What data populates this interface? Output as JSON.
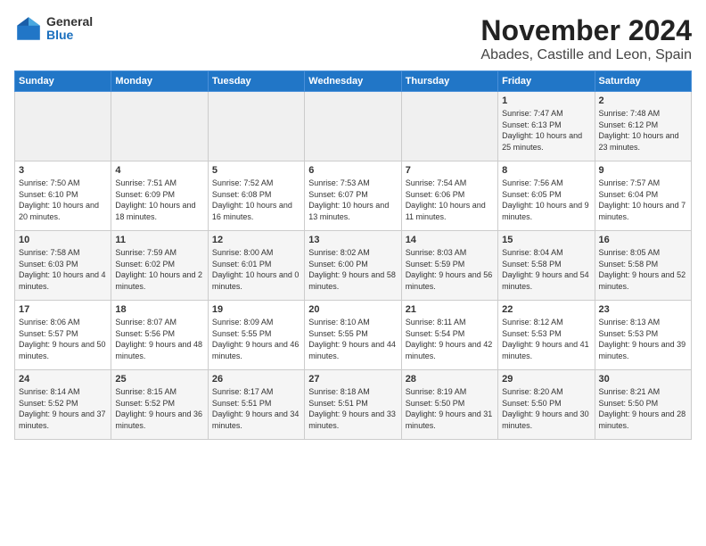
{
  "logo": {
    "general": "General",
    "blue": "Blue"
  },
  "title": "November 2024",
  "location": "Abades, Castille and Leon, Spain",
  "weekdays": [
    "Sunday",
    "Monday",
    "Tuesday",
    "Wednesday",
    "Thursday",
    "Friday",
    "Saturday"
  ],
  "weeks": [
    [
      {
        "day": "",
        "empty": true
      },
      {
        "day": "",
        "empty": true
      },
      {
        "day": "",
        "empty": true
      },
      {
        "day": "",
        "empty": true
      },
      {
        "day": "",
        "empty": true
      },
      {
        "day": "1",
        "sunrise": "7:47 AM",
        "sunset": "6:13 PM",
        "daylight": "10 hours and 25 minutes."
      },
      {
        "day": "2",
        "sunrise": "7:48 AM",
        "sunset": "6:12 PM",
        "daylight": "10 hours and 23 minutes."
      }
    ],
    [
      {
        "day": "3",
        "sunrise": "7:50 AM",
        "sunset": "6:10 PM",
        "daylight": "10 hours and 20 minutes."
      },
      {
        "day": "4",
        "sunrise": "7:51 AM",
        "sunset": "6:09 PM",
        "daylight": "10 hours and 18 minutes."
      },
      {
        "day": "5",
        "sunrise": "7:52 AM",
        "sunset": "6:08 PM",
        "daylight": "10 hours and 16 minutes."
      },
      {
        "day": "6",
        "sunrise": "7:53 AM",
        "sunset": "6:07 PM",
        "daylight": "10 hours and 13 minutes."
      },
      {
        "day": "7",
        "sunrise": "7:54 AM",
        "sunset": "6:06 PM",
        "daylight": "10 hours and 11 minutes."
      },
      {
        "day": "8",
        "sunrise": "7:56 AM",
        "sunset": "6:05 PM",
        "daylight": "10 hours and 9 minutes."
      },
      {
        "day": "9",
        "sunrise": "7:57 AM",
        "sunset": "6:04 PM",
        "daylight": "10 hours and 7 minutes."
      }
    ],
    [
      {
        "day": "10",
        "sunrise": "7:58 AM",
        "sunset": "6:03 PM",
        "daylight": "10 hours and 4 minutes."
      },
      {
        "day": "11",
        "sunrise": "7:59 AM",
        "sunset": "6:02 PM",
        "daylight": "10 hours and 2 minutes."
      },
      {
        "day": "12",
        "sunrise": "8:00 AM",
        "sunset": "6:01 PM",
        "daylight": "10 hours and 0 minutes."
      },
      {
        "day": "13",
        "sunrise": "8:02 AM",
        "sunset": "6:00 PM",
        "daylight": "9 hours and 58 minutes."
      },
      {
        "day": "14",
        "sunrise": "8:03 AM",
        "sunset": "5:59 PM",
        "daylight": "9 hours and 56 minutes."
      },
      {
        "day": "15",
        "sunrise": "8:04 AM",
        "sunset": "5:58 PM",
        "daylight": "9 hours and 54 minutes."
      },
      {
        "day": "16",
        "sunrise": "8:05 AM",
        "sunset": "5:58 PM",
        "daylight": "9 hours and 52 minutes."
      }
    ],
    [
      {
        "day": "17",
        "sunrise": "8:06 AM",
        "sunset": "5:57 PM",
        "daylight": "9 hours and 50 minutes."
      },
      {
        "day": "18",
        "sunrise": "8:07 AM",
        "sunset": "5:56 PM",
        "daylight": "9 hours and 48 minutes."
      },
      {
        "day": "19",
        "sunrise": "8:09 AM",
        "sunset": "5:55 PM",
        "daylight": "9 hours and 46 minutes."
      },
      {
        "day": "20",
        "sunrise": "8:10 AM",
        "sunset": "5:55 PM",
        "daylight": "9 hours and 44 minutes."
      },
      {
        "day": "21",
        "sunrise": "8:11 AM",
        "sunset": "5:54 PM",
        "daylight": "9 hours and 42 minutes."
      },
      {
        "day": "22",
        "sunrise": "8:12 AM",
        "sunset": "5:53 PM",
        "daylight": "9 hours and 41 minutes."
      },
      {
        "day": "23",
        "sunrise": "8:13 AM",
        "sunset": "5:53 PM",
        "daylight": "9 hours and 39 minutes."
      }
    ],
    [
      {
        "day": "24",
        "sunrise": "8:14 AM",
        "sunset": "5:52 PM",
        "daylight": "9 hours and 37 minutes."
      },
      {
        "day": "25",
        "sunrise": "8:15 AM",
        "sunset": "5:52 PM",
        "daylight": "9 hours and 36 minutes."
      },
      {
        "day": "26",
        "sunrise": "8:17 AM",
        "sunset": "5:51 PM",
        "daylight": "9 hours and 34 minutes."
      },
      {
        "day": "27",
        "sunrise": "8:18 AM",
        "sunset": "5:51 PM",
        "daylight": "9 hours and 33 minutes."
      },
      {
        "day": "28",
        "sunrise": "8:19 AM",
        "sunset": "5:50 PM",
        "daylight": "9 hours and 31 minutes."
      },
      {
        "day": "29",
        "sunrise": "8:20 AM",
        "sunset": "5:50 PM",
        "daylight": "9 hours and 30 minutes."
      },
      {
        "day": "30",
        "sunrise": "8:21 AM",
        "sunset": "5:50 PM",
        "daylight": "9 hours and 28 minutes."
      }
    ]
  ]
}
